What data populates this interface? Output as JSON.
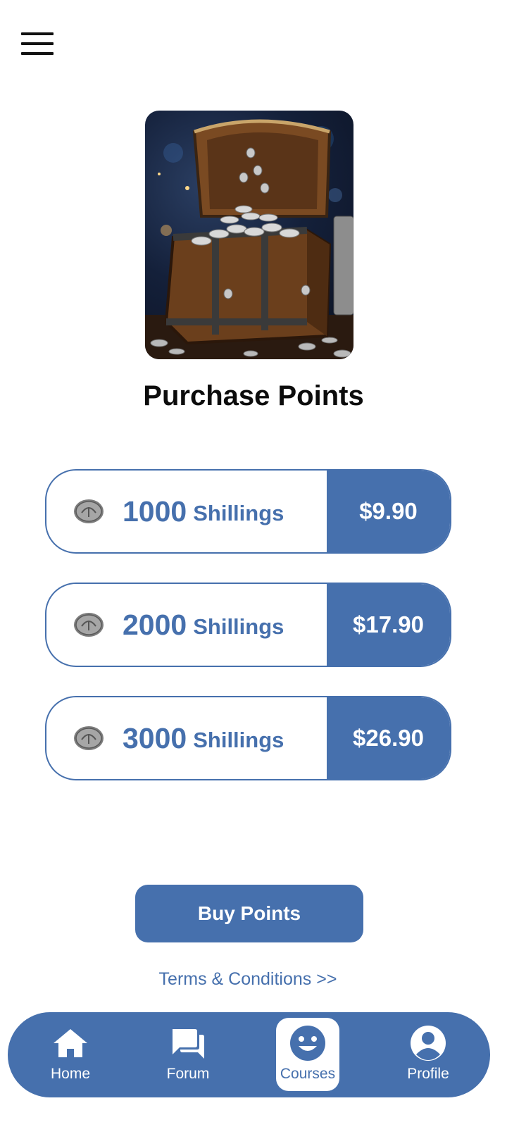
{
  "header": {
    "menu_icon": "hamburger-menu-icon"
  },
  "hero": {
    "image": "treasure-chest-with-coins"
  },
  "title": "Purchase Points",
  "packages": [
    {
      "amount": "1000",
      "unit": "Shillings",
      "price": "$9.90",
      "icon": "coin-icon"
    },
    {
      "amount": "2000",
      "unit": "Shillings",
      "price": "$17.90",
      "icon": "coin-icon"
    },
    {
      "amount": "3000",
      "unit": "Shillings",
      "price": "$26.90",
      "icon": "coin-icon"
    }
  ],
  "buy_button": "Buy Points",
  "terms_link": "Terms & Conditions >>",
  "nav": {
    "items": [
      {
        "label": "Home",
        "icon": "home-icon",
        "active": false
      },
      {
        "label": "Forum",
        "icon": "forum-icon",
        "active": false
      },
      {
        "label": "Courses",
        "icon": "smiley-icon",
        "active": true
      },
      {
        "label": "Profile",
        "icon": "profile-icon",
        "active": false
      }
    ]
  },
  "colors": {
    "accent": "#4670ad",
    "background": "#ffffff",
    "title": "#0c0c0c"
  }
}
